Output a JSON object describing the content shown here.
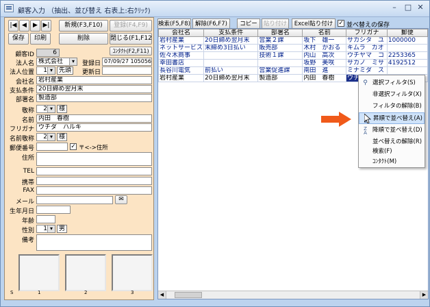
{
  "window": {
    "title": "顧客入力 （抽出、並び替え 右表上:右ｸﾘｯｸ)"
  },
  "nav": {
    "first": "|◀",
    "prev": "◀",
    "next": "▶",
    "last": "▶|"
  },
  "buttons": {
    "new": "新規(F3,F10)",
    "register": "登録(F4,F9)",
    "save": "保存",
    "print": "印刷",
    "delete": "削除",
    "close": "閉じる(F1,F12)",
    "contact": "ｺﾝﾀｸﾄ(F2,F11)"
  },
  "form": {
    "customer_id_label": "顧客ID",
    "customer_id": "6",
    "corp_name_label": "法人名",
    "corp_name": "株式会社",
    "reg_date_label": "登録日",
    "reg_date": "07/09/27 105056",
    "corp_pos_label": "法人位置",
    "corp_pos": "1",
    "corp_pos_tag": "先頭",
    "update_label": "更新日",
    "update": "",
    "company_label": "会社名",
    "company": "岩村産業",
    "payment_label": "支払条件",
    "payment": "20日締め翌月末",
    "dept_label": "部署名",
    "dept": "製造部",
    "honor_label": "敬称",
    "honor": "2",
    "honor_tag": "様",
    "name_label": "名前",
    "name": "内田　春樹",
    "furigana_label": "フリガナ",
    "furigana": "ウチダ　ハルキ",
    "name_honor_label": "名前敬称",
    "name_honor": "2",
    "name_honor_tag": "様",
    "zip_label": "郵便番号",
    "zip": "",
    "zip_check_label": "〒<->住所",
    "address_label": "住所",
    "tel_label": "TEL",
    "mobile_label": "携帯",
    "fax_label": "FAX",
    "mail_label": "メール",
    "birth_label": "生年月日",
    "age_label": "年齢",
    "gender_label": "性別",
    "gender": "1",
    "gender_tag": "男",
    "note_label": "備考"
  },
  "photos": {
    "s": "S",
    "p1": "1",
    "p2": "2",
    "p3": "3"
  },
  "toolbar": {
    "search": "検索(F5,F8)",
    "release": "解除(F6,F7)",
    "copy": "コピー",
    "paste": "貼り付け",
    "excel_paste": "Excel貼り付け",
    "keep_sort": "並べ替えの保存"
  },
  "table": {
    "headers": [
      "会社名",
      "支払条件",
      "部署名",
      "名前",
      "フリガナ",
      "郵便"
    ],
    "rows": [
      [
        "岩村産業",
        "20日締め翌月末",
        "営業２課",
        "坂下　雄一",
        "サカシタ　ユ",
        "1000000"
      ],
      [
        "ネットサービス",
        "末締め3日払い",
        "販売部",
        "木村　かおる",
        "キムラ　カオ",
        ""
      ],
      [
        "佐々木商事",
        "",
        "技術１課",
        "内山　高次",
        "ウチヤマ　コ",
        "2253365"
      ],
      [
        "幸田書店",
        "",
        "",
        "坂野　美咲",
        "サカノ　ミサ",
        "4192512"
      ],
      [
        "長谷川電気",
        "前払い",
        "営業促進課",
        "南田　進",
        "ミナミダ　ス",
        ""
      ],
      [
        "岩村産業",
        "20日締め翌月末",
        "製造部",
        "内田　春樹",
        "ウチダ　ハル",
        ""
      ]
    ]
  },
  "context_menu": {
    "items": [
      {
        "label": "選択フィルタ(S)",
        "icon": "filter-icon"
      },
      {
        "label": "非選択フィルタ(X)",
        "icon": ""
      },
      {
        "label": "フィルタの解除(B)",
        "icon": ""
      },
      {
        "label": "昇順で並べ替え(A)",
        "icon": "sort-asc-icon"
      },
      {
        "label": "降順で並べ替え(D)",
        "icon": "sort-desc-icon"
      },
      {
        "label": "並べ替えの解除(R)",
        "icon": ""
      },
      {
        "label": "検索(F)",
        "icon": ""
      },
      {
        "label": "ｺﾝﾀｸﾄ(M)",
        "icon": ""
      }
    ],
    "highlighted_index": 3
  },
  "colors": {
    "accent_arrow": "#f05a1a",
    "selection": "#1b2f8a",
    "form_bg": "#fce4c4"
  }
}
